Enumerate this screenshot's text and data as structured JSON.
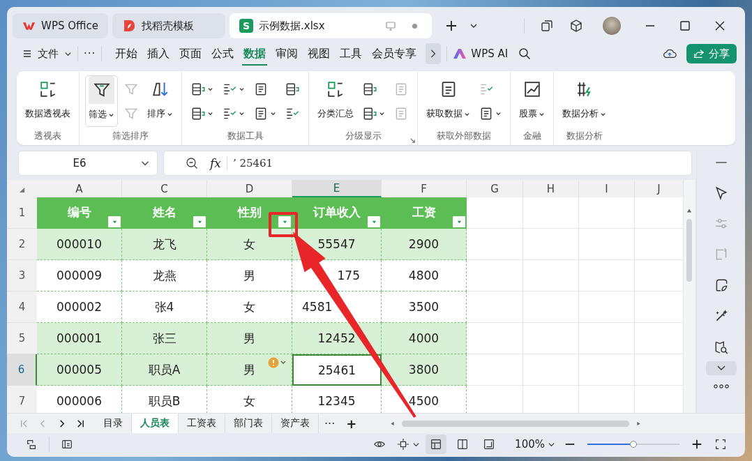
{
  "window": {
    "tabs": [
      {
        "label": "WPS Office",
        "kind": "wps",
        "selected": false
      },
      {
        "label": "找稻壳模板",
        "kind": "docer",
        "selected": false
      },
      {
        "label": "示例数据.xlsx",
        "kind": "sheet",
        "logo_text": "S",
        "selected": true
      }
    ]
  },
  "menu": {
    "file": "文件",
    "more": "···",
    "tabs": [
      {
        "label": "开始",
        "selected": false
      },
      {
        "label": "插入",
        "selected": false
      },
      {
        "label": "页面",
        "selected": false
      },
      {
        "label": "公式",
        "selected": false
      },
      {
        "label": "数据",
        "selected": true
      },
      {
        "label": "审阅",
        "selected": false
      },
      {
        "label": "视图",
        "selected": false
      },
      {
        "label": "工具",
        "selected": false
      },
      {
        "label": "会员专享",
        "selected": false
      }
    ],
    "ai": "WPS AI",
    "share": "分享"
  },
  "ribbon": {
    "groups": [
      {
        "title": "透视表",
        "launcher": false,
        "columns": [
          {
            "kind": "large",
            "label": "数据透视表",
            "dropdown": false,
            "pressed": false
          }
        ]
      },
      {
        "title": "筛选排序",
        "launcher": false,
        "columns": [
          {
            "kind": "large",
            "label": "筛选",
            "dropdown": true,
            "pressed": true
          },
          {
            "kind": "stack",
            "buttons": [
              {
                "dropdown": false,
                "disabled": true
              },
              {
                "dropdown": false,
                "disabled": true
              }
            ]
          },
          {
            "kind": "large",
            "label": "排序",
            "dropdown": true,
            "pressed": false
          }
        ]
      },
      {
        "title": "数据工具",
        "launcher": false,
        "columns": [
          {
            "kind": "stack",
            "buttons": [
              {
                "dropdown": true,
                "disabled": false
              },
              {
                "dropdown": true,
                "disabled": false
              }
            ]
          },
          {
            "kind": "stack",
            "buttons": [
              {
                "dropdown": true,
                "disabled": false
              },
              {
                "dropdown": true,
                "disabled": false
              }
            ]
          },
          {
            "kind": "stack",
            "buttons": [
              {
                "dropdown": false,
                "disabled": false
              },
              {
                "dropdown": true,
                "disabled": false
              }
            ]
          },
          {
            "kind": "stack",
            "buttons": [
              {
                "dropdown": false,
                "disabled": false
              },
              {
                "dropdown": false,
                "disabled": false
              }
            ]
          }
        ]
      },
      {
        "title": "分级显示",
        "launcher": true,
        "columns": [
          {
            "kind": "large",
            "label": "分类汇总",
            "dropdown": false,
            "pressed": false
          },
          {
            "kind": "stack",
            "buttons": [
              {
                "dropdown": false,
                "disabled": false
              },
              {
                "dropdown": true,
                "disabled": false
              }
            ]
          },
          {
            "kind": "stack",
            "buttons": [
              {
                "dropdown": false,
                "disabled": true
              },
              {
                "dropdown": false,
                "disabled": true
              }
            ]
          }
        ]
      },
      {
        "title": "获取外部数据",
        "launcher": false,
        "columns": [
          {
            "kind": "large",
            "label": "获取数据",
            "dropdown": true,
            "pressed": false
          },
          {
            "kind": "stack",
            "buttons": [
              {
                "dropdown": false,
                "disabled": true
              },
              {
                "dropdown": true,
                "disabled": false
              }
            ]
          }
        ]
      },
      {
        "title": "金融",
        "launcher": false,
        "columns": [
          {
            "kind": "large",
            "label": "股票",
            "dropdown": true,
            "pressed": false
          }
        ]
      },
      {
        "title": "数据分析",
        "launcher": false,
        "columns": [
          {
            "kind": "large",
            "label": "数据分析",
            "dropdown": true,
            "pressed": false
          }
        ]
      }
    ]
  },
  "formula_bar": {
    "name_box": "E6",
    "fx": "fx",
    "formula": "’ 25461"
  },
  "sheet": {
    "columns": [
      {
        "label": "A",
        "selected": false
      },
      {
        "label": "C",
        "selected": false
      },
      {
        "label": "D",
        "selected": false
      },
      {
        "label": "E",
        "selected": true
      },
      {
        "label": "F",
        "selected": false
      },
      {
        "label": "G",
        "selected": false
      },
      {
        "label": "H",
        "selected": false
      },
      {
        "label": "I",
        "selected": false
      },
      {
        "label": "J",
        "selected": false
      }
    ],
    "rows": [
      {
        "header": "1",
        "kind": "header",
        "shaded": false,
        "selected": false,
        "warning": false,
        "cells": [
          "编号",
          "姓名",
          "性别",
          "订单收入",
          "工资"
        ]
      },
      {
        "header": "2",
        "kind": "data",
        "shaded": true,
        "selected": false,
        "warning": false,
        "cells": [
          "000010",
          "龙飞",
          "女",
          "55547",
          "2900"
        ]
      },
      {
        "header": "3",
        "kind": "data",
        "shaded": false,
        "selected": false,
        "warning": false,
        "cells": [
          "000009",
          "龙燕",
          "男",
          {
            "text": "175",
            "kind": "tail"
          },
          "4800"
        ]
      },
      {
        "header": "4",
        "kind": "data",
        "shaded": false,
        "selected": false,
        "warning": false,
        "cells": [
          "000002",
          "张4",
          "女",
          {
            "text": "4581",
            "kind": "head"
          },
          "3500"
        ]
      },
      {
        "header": "5",
        "kind": "data",
        "shaded": true,
        "selected": false,
        "warning": false,
        "cells": [
          "000001",
          "张三",
          "男",
          "12452",
          "4000"
        ]
      },
      {
        "header": "6",
        "kind": "data",
        "shaded": true,
        "selected": true,
        "warning": true,
        "cells": [
          "000005",
          "职员A",
          "男",
          "25461",
          "3800"
        ]
      },
      {
        "header": "7",
        "kind": "data",
        "shaded": false,
        "selected": false,
        "warning": false,
        "cells": [
          "000006",
          "职员B",
          "女",
          "12345",
          "4500"
        ]
      }
    ]
  },
  "sheet_tabs": {
    "tabs": [
      {
        "label": "目录",
        "selected": false
      },
      {
        "label": "人员表",
        "selected": true
      },
      {
        "label": "工资表",
        "selected": false
      },
      {
        "label": "部门表",
        "selected": false
      },
      {
        "label": "资产表",
        "selected": false
      }
    ],
    "more": "···",
    "add": "+"
  },
  "status_bar": {
    "views": [
      {
        "selected": true
      },
      {
        "selected": false
      },
      {
        "selected": false
      }
    ],
    "zoom": "100%",
    "level": 0.5
  }
}
